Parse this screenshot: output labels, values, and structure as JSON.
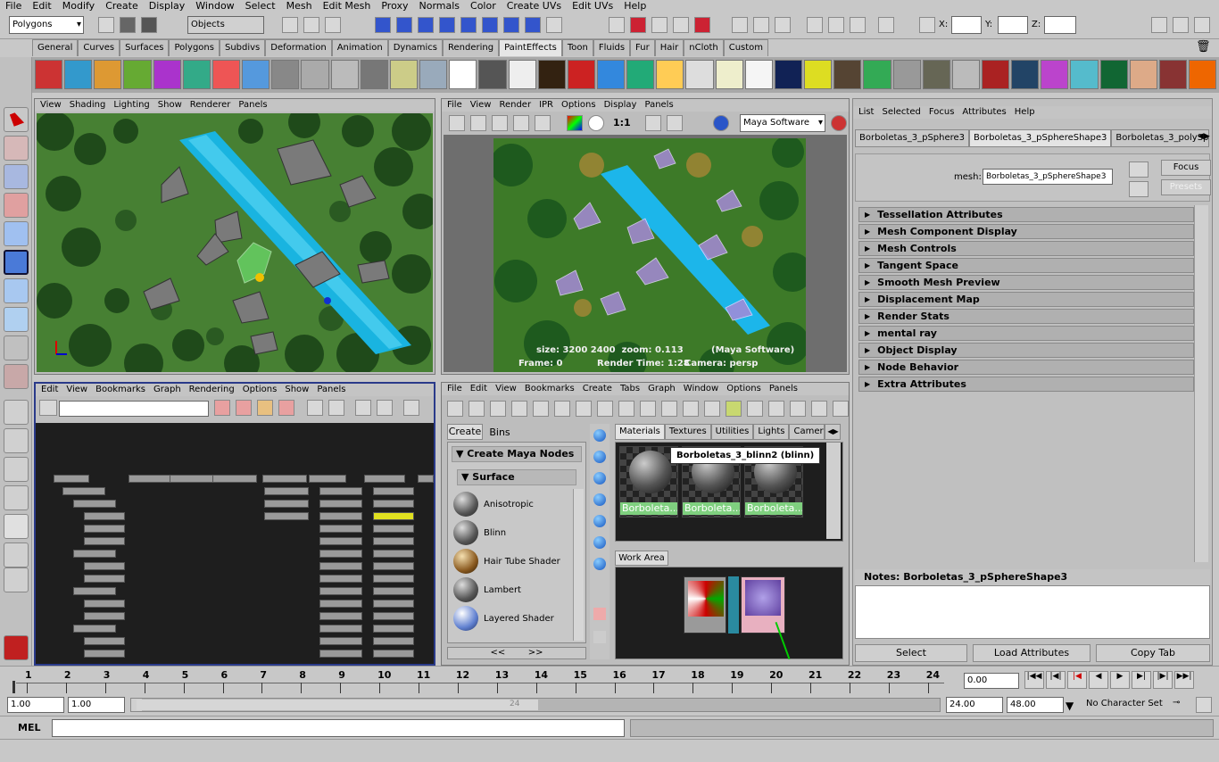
{
  "menubar": [
    "File",
    "Edit",
    "Modify",
    "Create",
    "Display",
    "Window",
    "Select",
    "Mesh",
    "Edit Mesh",
    "Proxy",
    "Normals",
    "Color",
    "Create UVs",
    "Edit UVs",
    "Help"
  ],
  "toolbar": {
    "mode": "Polygons",
    "objects_label": "Objects",
    "x_label": "X:",
    "y_label": "Y:",
    "z_label": "Z:"
  },
  "shelf_tabs": [
    "General",
    "Curves",
    "Surfaces",
    "Polygons",
    "Subdivs",
    "Deformation",
    "Animation",
    "Dynamics",
    "Rendering",
    "PaintEffects",
    "Toon",
    "Fluids",
    "Fur",
    "Hair",
    "nCloth",
    "Custom"
  ],
  "shelf_active": "PaintEffects",
  "viewport": {
    "menu": [
      "View",
      "Shading",
      "Lighting",
      "Show",
      "Renderer",
      "Panels"
    ]
  },
  "render_view": {
    "menu": [
      "File",
      "View",
      "Render",
      "IPR",
      "Options",
      "Display",
      "Panels"
    ],
    "ratio": "1:1",
    "renderer": "Maya Software",
    "info_line1": "size: 3200 2400  zoom: 0.113         (Maya Software)",
    "info_frame": "Frame: 0",
    "info_time": "Render Time: 1:28",
    "info_camera": "Camera: persp"
  },
  "attribute_editor": {
    "menu": [
      "List",
      "Selected",
      "Focus",
      "Attributes",
      "Help"
    ],
    "tabs": [
      "Borboletas_3_pSphere3",
      "Borboletas_3_pSphereShape3",
      "Borboletas_3_polySp"
    ],
    "mesh_label": "mesh:",
    "mesh_value": "Borboletas_3_pSphereShape3",
    "focus": "Focus",
    "presets": "Presets",
    "sections": [
      "Tessellation Attributes",
      "Mesh Component Display",
      "Mesh Controls",
      "Tangent Space",
      "Smooth Mesh Preview",
      "Displacement Map",
      "Render Stats",
      "mental ray",
      "Object Display",
      "Node Behavior",
      "Extra Attributes"
    ],
    "notes_label": "Notes:  Borboletas_3_pSphereShape3",
    "select": "Select",
    "load": "Load Attributes",
    "copy": "Copy Tab"
  },
  "hypergraph": {
    "menu": [
      "Edit",
      "View",
      "Bookmarks",
      "Graph",
      "Rendering",
      "Options",
      "Show",
      "Panels"
    ]
  },
  "hypershade": {
    "menu": [
      "File",
      "Edit",
      "View",
      "Bookmarks",
      "Create",
      "Tabs",
      "Graph",
      "Window",
      "Options",
      "Panels"
    ],
    "create_tab": "Create",
    "bins_tab": "Bins",
    "create_nodes": "Create Maya Nodes",
    "surface": "Surface",
    "shaders": [
      "Anisotropic",
      "Blinn",
      "Hair Tube Shader",
      "Lambert",
      "Layered Shader"
    ],
    "tabs": [
      "Materials",
      "Textures",
      "Utilities",
      "Lights",
      "Cameras"
    ],
    "tooltip": "Borboletas_3_blinn2 (blinn)",
    "material_labels": [
      "Borboleta...",
      "Borboleta...",
      "Borboleta..."
    ],
    "work_area": "Work Area"
  },
  "timeline": {
    "ticks": [
      "1",
      "2",
      "3",
      "4",
      "5",
      "6",
      "7",
      "8",
      "9",
      "10",
      "11",
      "12",
      "13",
      "14",
      "15",
      "16",
      "17",
      "18",
      "19",
      "20",
      "21",
      "22",
      "23",
      "24"
    ],
    "current": "0.00"
  },
  "range": {
    "start": "1.00",
    "start2": "1.00",
    "handle": "24",
    "end": "24.00",
    "end2": "48.00",
    "charset": "No Character Set"
  },
  "command": {
    "label": "MEL"
  }
}
